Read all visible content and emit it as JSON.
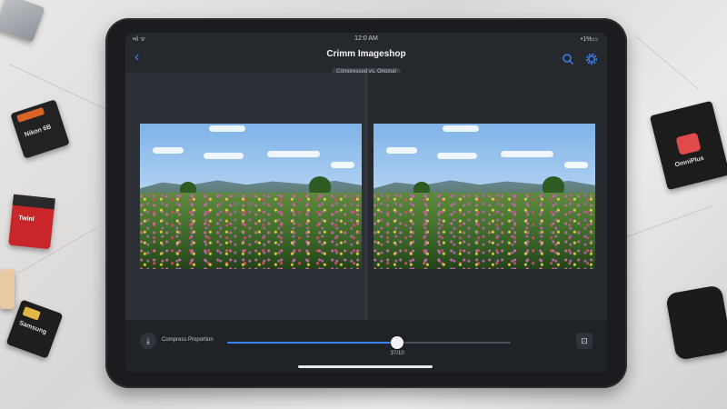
{
  "status_bar": {
    "time": "12:0 AM",
    "signal": "•ıl ᯤ",
    "battery": "•1%▭"
  },
  "nav": {
    "back_icon": "chevron-left-icon",
    "title": "Crimm Imageshop",
    "subtitle": "Cömpressed vs. Original",
    "search_icon": "search-icon",
    "settings_icon": "gear-icon"
  },
  "comparison": {
    "left_label": "",
    "right_label": ""
  },
  "bottom_bar": {
    "left_icon": "compress-icon",
    "label": "Compress Proportion",
    "slider": {
      "value": 0.6,
      "display": "37/10"
    },
    "right_icon": "crop-icon"
  },
  "colors": {
    "accent": "#3b82f6",
    "screen_bg": "#25282d",
    "bar_bg": "#1f2227"
  },
  "props": {
    "card_top_left": "Nikon 6B",
    "card_mid_left": "Twinl",
    "card_bottom_left": "Samsung",
    "card_right": "OmniPlus"
  }
}
